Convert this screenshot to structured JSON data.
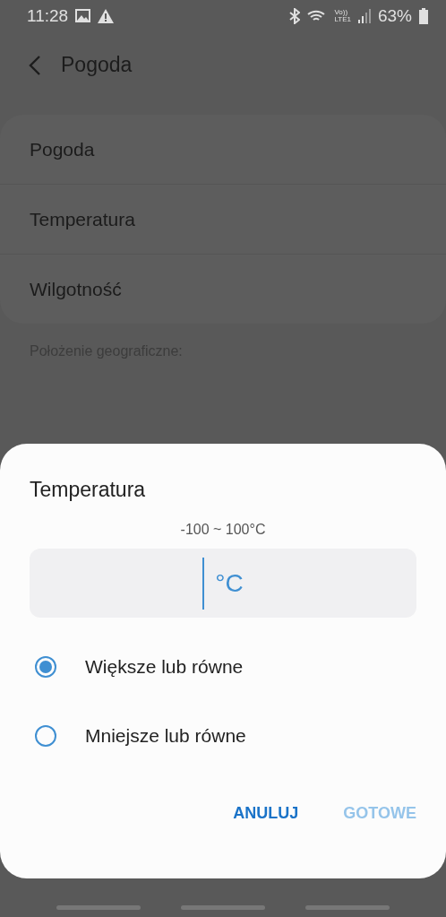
{
  "status_bar": {
    "time": "11:28",
    "battery": "63%",
    "volte": "Vo))",
    "lte": "LTE1"
  },
  "header": {
    "title": "Pogoda"
  },
  "settings": [
    {
      "label": "Pogoda"
    },
    {
      "label": "Temperatura"
    },
    {
      "label": "Wilgotność"
    }
  ],
  "location_label": "Położenie geograficzne:",
  "dialog": {
    "title": "Temperatura",
    "range": "-100 ~ 100°C",
    "unit": "°C",
    "options": [
      {
        "label": "Większe lub równe",
        "selected": true
      },
      {
        "label": "Mniejsze lub równe",
        "selected": false
      }
    ],
    "buttons": [
      {
        "label": "ANULUJ",
        "disabled": false
      },
      {
        "label": "GOTOWE",
        "disabled": true
      }
    ]
  }
}
